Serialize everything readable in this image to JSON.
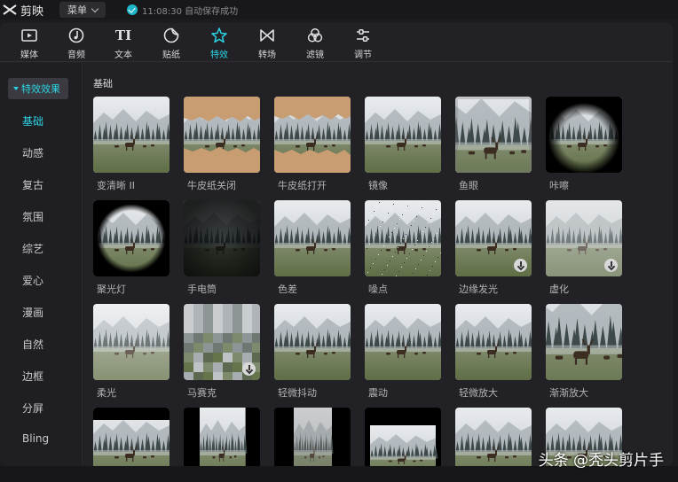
{
  "app": {
    "title": "剪映",
    "menu_label": "菜单",
    "save_status": "11:08:30 自动保存成功"
  },
  "toolbar": [
    {
      "label": "媒体",
      "icon": "media-icon"
    },
    {
      "label": "音频",
      "icon": "audio-icon"
    },
    {
      "label": "文本",
      "icon": "text-icon"
    },
    {
      "label": "贴纸",
      "icon": "sticker-icon"
    },
    {
      "label": "特效",
      "icon": "effects-icon",
      "active": true
    },
    {
      "label": "转场",
      "icon": "transition-icon"
    },
    {
      "label": "滤镜",
      "icon": "filter-icon"
    },
    {
      "label": "调节",
      "icon": "adjust-icon"
    }
  ],
  "sidebar": {
    "header": "特效效果",
    "items": [
      "基础",
      "动感",
      "复古",
      "氛围",
      "综艺",
      "爱心",
      "漫画",
      "自然",
      "边框",
      "分屏",
      "Bling"
    ],
    "active_index": 0
  },
  "section_title": "基础",
  "effects": [
    {
      "label": "变清晰 II",
      "style": "normal"
    },
    {
      "label": "牛皮纸关闭",
      "style": "kraft"
    },
    {
      "label": "牛皮纸打开",
      "style": "kraft2"
    },
    {
      "label": "镜像",
      "style": "normal"
    },
    {
      "label": "鱼眼",
      "style": "fisheye"
    },
    {
      "label": "咔嚓",
      "style": "vignette-oval"
    },
    {
      "label": "聚光灯",
      "style": "spotlight"
    },
    {
      "label": "手电筒",
      "style": "dark"
    },
    {
      "label": "色差",
      "style": "normal"
    },
    {
      "label": "噪点",
      "style": "noise"
    },
    {
      "label": "边缘发光",
      "style": "normal",
      "download": true
    },
    {
      "label": "虚化",
      "style": "blur",
      "download": true
    },
    {
      "label": "柔光",
      "style": "soft"
    },
    {
      "label": "马赛克",
      "style": "mosaic",
      "download": true
    },
    {
      "label": "轻微抖动",
      "style": "normal"
    },
    {
      "label": "震动",
      "style": "normal"
    },
    {
      "label": "轻微放大",
      "style": "normal"
    },
    {
      "label": "渐渐放大",
      "style": "zoom"
    },
    {
      "label": "",
      "style": "bars"
    },
    {
      "label": "",
      "style": "narrow"
    },
    {
      "label": "",
      "style": "narrow2"
    },
    {
      "label": "",
      "style": "box"
    },
    {
      "label": "",
      "style": "normal"
    },
    {
      "label": "",
      "style": "normal"
    }
  ],
  "watermark": "头条 @秃头剪片手"
}
